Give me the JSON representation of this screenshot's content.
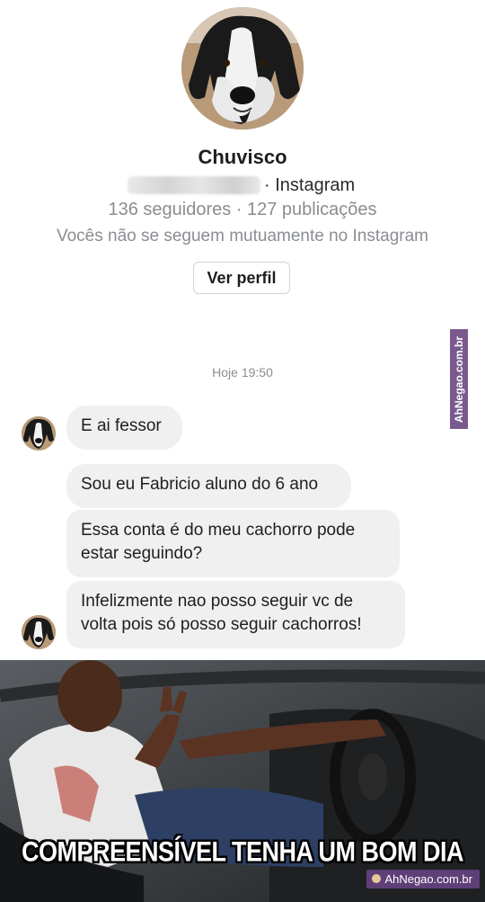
{
  "profile": {
    "name": "Chuvisco",
    "platform": "· Instagram",
    "stats": "136 seguidores · 127 publicações",
    "mutual": "Vocês não se seguem mutuamente no Instagram",
    "view_button": "Ver perfil"
  },
  "watermark_side": "AhNegao.com.br",
  "chat": {
    "timestamp": "Hoje 19:50",
    "messages": [
      {
        "text": "E ai fessor"
      },
      {
        "text": "Sou eu Fabricio aluno do 6 ano"
      },
      {
        "text": "Essa conta é do meu cachorro pode estar seguindo?"
      },
      {
        "text": "Infelizmente nao posso seguir vc de volta pois só posso seguir cachorros!"
      }
    ]
  },
  "meme": {
    "caption": "COMPREENSÍVEL TENHA UM BOM DIA",
    "credit": "AhNegao.com.br"
  },
  "colors": {
    "bubble": "#f1f0f0",
    "muted_text": "#8a8d91",
    "watermark": "#7a5a8e"
  }
}
